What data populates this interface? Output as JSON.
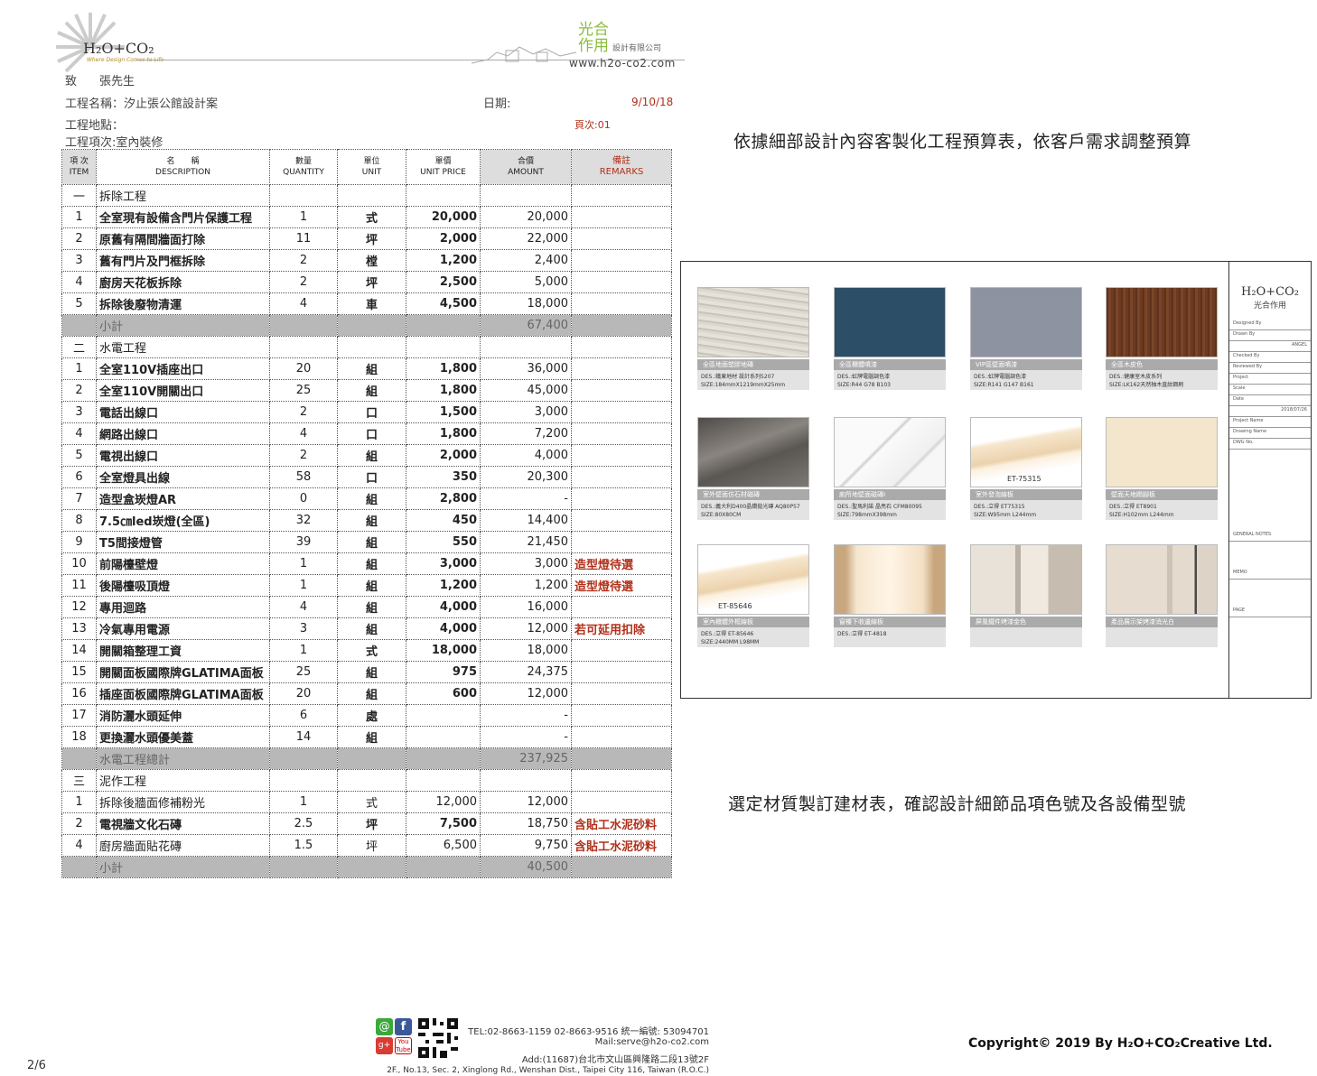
{
  "header": {
    "logo": "H₂O+CO₂",
    "logo_tagline": "Where Design Comes to Life",
    "brand_cn_1": "光合",
    "brand_cn_2": "作用",
    "brand_cn_small": "設計有限公司",
    "brand_url": "www.h2o-co2.com",
    "to_label": "致",
    "to_name": "張先生",
    "project_label": "工程名稱：汐止張公館設計案",
    "date_label": "日期:",
    "date_value": "9/10/18",
    "location_label": "工程地點：",
    "page_label": "頁次:01",
    "category_label": "工程項次:室內裝修"
  },
  "table": {
    "headers": {
      "item_cn": "項 次",
      "item_en": "ITEM",
      "desc_cn": "名　　稱",
      "desc_en": "DESCRIPTION",
      "qty_cn": "數量",
      "qty_en": "QUANTITY",
      "unit_cn": "單位",
      "unit_en": "UNIT",
      "price_cn": "單價",
      "price_en": "UNIT PRICE",
      "amount_cn": "合價",
      "amount_en": "AMOUNT",
      "remarks_cn": "備註",
      "remarks_en": "REMARKS"
    },
    "rows": [
      {
        "type": "section",
        "num": "一",
        "desc": "拆除工程"
      },
      {
        "type": "item",
        "num": "1",
        "desc": "全室現有設備含門片保護工程",
        "qty": "1",
        "unit": "式",
        "price": "20,000",
        "amount": "20,000",
        "rem": ""
      },
      {
        "type": "item",
        "num": "2",
        "desc": "原舊有隔間牆面打除",
        "qty": "11",
        "unit": "坪",
        "price": "2,000",
        "amount": "22,000",
        "rem": ""
      },
      {
        "type": "item",
        "num": "3",
        "desc": "舊有門片及門框拆除",
        "qty": "2",
        "unit": "樘",
        "price": "1,200",
        "amount": "2,400",
        "rem": ""
      },
      {
        "type": "item",
        "num": "4",
        "desc": "廚房天花板拆除",
        "qty": "2",
        "unit": "坪",
        "price": "2,500",
        "amount": "5,000",
        "rem": ""
      },
      {
        "type": "item",
        "num": "5",
        "desc": "拆除後廢物清運",
        "qty": "4",
        "unit": "車",
        "price": "4,500",
        "amount": "18,000",
        "rem": ""
      },
      {
        "type": "subtotal",
        "num": "",
        "desc": "小計",
        "amount": "67,400"
      },
      {
        "type": "section",
        "num": "二",
        "desc": "水電工程"
      },
      {
        "type": "item",
        "num": "1",
        "desc": "全室110V插座出口",
        "qty": "20",
        "unit": "組",
        "price": "1,800",
        "amount": "36,000",
        "rem": ""
      },
      {
        "type": "item",
        "num": "2",
        "desc": "全室110V開關出口",
        "qty": "25",
        "unit": "組",
        "price": "1,800",
        "amount": "45,000",
        "rem": ""
      },
      {
        "type": "item",
        "num": "3",
        "desc": "電話出線口",
        "qty": "2",
        "unit": "口",
        "price": "1,500",
        "amount": "3,000",
        "rem": ""
      },
      {
        "type": "item",
        "num": "4",
        "desc": "網路出線口",
        "qty": "4",
        "unit": "口",
        "price": "1,800",
        "amount": "7,200",
        "rem": ""
      },
      {
        "type": "item",
        "num": "5",
        "desc": "電視出線口",
        "qty": "2",
        "unit": "組",
        "price": "2,000",
        "amount": "4,000",
        "rem": ""
      },
      {
        "type": "item",
        "num": "6",
        "desc": "全室燈具出線",
        "qty": "58",
        "unit": "口",
        "price": "350",
        "amount": "20,300",
        "rem": ""
      },
      {
        "type": "item",
        "num": "7",
        "desc": "造型盒崁燈AR",
        "qty": "0",
        "unit": "組",
        "price": "2,800",
        "amount": "-",
        "rem": ""
      },
      {
        "type": "item",
        "num": "8",
        "desc": "7.5㎝led崁燈(全區)",
        "qty": "32",
        "unit": "組",
        "price": "450",
        "amount": "14,400",
        "rem": ""
      },
      {
        "type": "item",
        "num": "9",
        "desc": "T5間接燈管",
        "qty": "39",
        "unit": "組",
        "price": "550",
        "amount": "21,450",
        "rem": ""
      },
      {
        "type": "item",
        "num": "10",
        "desc": "前陽檯壁燈",
        "qty": "1",
        "unit": "組",
        "price": "3,000",
        "amount": "3,000",
        "rem": "造型燈待選"
      },
      {
        "type": "item",
        "num": "11",
        "desc": "後陽檯吸頂燈",
        "qty": "1",
        "unit": "組",
        "price": "1,200",
        "amount": "1,200",
        "rem": "造型燈待選"
      },
      {
        "type": "item",
        "num": "12",
        "desc": "專用迴路",
        "qty": "4",
        "unit": "組",
        "price": "4,000",
        "amount": "16,000",
        "rem": ""
      },
      {
        "type": "item",
        "num": "13",
        "desc": "冷氣專用電源",
        "qty": "3",
        "unit": "組",
        "price": "4,000",
        "amount": "12,000",
        "rem": "若可延用扣除"
      },
      {
        "type": "item",
        "num": "14",
        "desc": "開關箱整理工資",
        "qty": "1",
        "unit": "式",
        "price": "18,000",
        "amount": "18,000",
        "rem": ""
      },
      {
        "type": "item",
        "num": "15",
        "desc": "開關面板國際牌GLATIMA面板",
        "qty": "25",
        "unit": "組",
        "price": "975",
        "amount": "24,375",
        "rem": ""
      },
      {
        "type": "item",
        "num": "16",
        "desc": "插座面板國際牌GLATIMA面板",
        "qty": "20",
        "unit": "組",
        "price": "600",
        "amount": "12,000",
        "rem": ""
      },
      {
        "type": "item",
        "num": "17",
        "desc": "消防灑水頭延伸",
        "qty": "6",
        "unit": "處",
        "price": "",
        "amount": "-",
        "rem": ""
      },
      {
        "type": "item",
        "num": "18",
        "desc": "更換灑水頭優美蓋",
        "qty": "14",
        "unit": "組",
        "price": "",
        "amount": "-",
        "rem": ""
      },
      {
        "type": "subtotal",
        "num": "",
        "desc": "水電工程總計",
        "amount": "237,925"
      },
      {
        "type": "section",
        "num": "三",
        "desc": "泥作工程"
      },
      {
        "type": "item2",
        "num": "1",
        "desc": "拆除後牆面修補粉光",
        "qty": "1",
        "unit": "式",
        "price": "12,000",
        "amount": "12,000",
        "rem": ""
      },
      {
        "type": "item",
        "num": "2",
        "desc": "電視牆文化石磚",
        "qty": "2.5",
        "unit": "坪",
        "price": "7,500",
        "amount": "18,750",
        "rem": "含貼工水泥砂料"
      },
      {
        "type": "item2",
        "num": "4",
        "desc": "廚房牆面貼花磚",
        "qty": "1.5",
        "unit": "坪",
        "price": "6,500",
        "amount": "9,750",
        "rem": "含貼工水泥砂料"
      },
      {
        "type": "subtotal",
        "num": "",
        "desc": "小計",
        "amount": "40,500"
      }
    ]
  },
  "captions": {
    "budget": "依據細部設計內容客製化工程預算表，依客戶需求調整預算",
    "materials": "選定材質製訂建材表，確認設計細節品項色號及各設備型號"
  },
  "board": {
    "tiles": [
      {
        "name": "全區地面塑膠地磚",
        "desc1": "DES.:鐵東地材 設計系列5207",
        "desc2": "SIZE:184mmX1219mmX25mm",
        "color": "#d8d4cc",
        "style": "wood-light"
      },
      {
        "name": "全區櫃體噴漆",
        "desc1": "DES.:虹牌電腦調色漆",
        "desc2": "SIZE:R44 G78 B103",
        "color": "#2c4e67",
        "style": "solid"
      },
      {
        "name": "VIP區壁面噴漆",
        "desc1": "DES.:虹牌電腦調色漆",
        "desc2": "SIZE:R141 G147 B161",
        "color": "#8d93a1",
        "style": "solid"
      },
      {
        "name": "全區木皮色",
        "desc1": "DES.:健康室木皮系列",
        "desc2": "SIZE:LK162天然柚木直紋鋼刷",
        "color": "#6b3c22",
        "style": "wood-dark"
      },
      {
        "name": "室外壁面仿石材磁磚",
        "desc1": "DES.:義大利D400晶鑽拋光磚 AQ80P57",
        "desc2": "SIZE:80X80CM",
        "color": "#6e6a66",
        "style": "stone"
      },
      {
        "name": "廁所地壁面磁磚I",
        "desc1": "DES.:聖馬利諾 晶亮石 CFM80095",
        "desc2": "SIZE:798mmX398mm",
        "color": "#f2f2f2",
        "style": "marble"
      },
      {
        "name": "室外發泡線板",
        "desc1": "DES.:立得 ET75315",
        "desc2": "SIZE:W95mm L244mm",
        "color": "#f4e3c9",
        "style": "molding",
        "mlabel": "ET-75315"
      },
      {
        "name": "壁面天地踢腳板",
        "desc1": "DES.:立得 ET8901",
        "desc2": "SIZE:H102mm L244mm",
        "color": "#f3e6cd",
        "style": "solid"
      },
      {
        "name": "室內櫃體外框線板",
        "desc1": "DES.:立得 ET-85646",
        "desc2": "SIZE:2440MM L98MM",
        "color": "#f4e2c8",
        "style": "molding2",
        "mlabel": "ET-85646"
      },
      {
        "name": "窗檯下收邊線板",
        "desc1": "DES.:立得 ET-4818",
        "desc2": "",
        "color": "#f1dcc0",
        "style": "panel"
      },
      {
        "name": "屏風鐵件烤漆金色",
        "desc1": "",
        "desc2": "",
        "color": "#cfc6b8",
        "style": "bath"
      },
      {
        "name": "產品展示架烤漆消光白",
        "desc1": "",
        "desc2": "",
        "color": "#d9cfc2",
        "style": "shelf"
      }
    ],
    "titleblock": {
      "logo": "H₂O+CO₂",
      "sub": "光合作用",
      "rows": [
        "Designed By",
        "Drawn By",
        "Checked By",
        "Reviewed By",
        "Project",
        "Scale",
        "Date",
        "Project Name",
        "Drawing Name",
        "DWG No.",
        "GENERAL NOTES",
        "MEMO",
        "PAGE"
      ],
      "date": "2018/07/26",
      "drawn": "ANGEL"
    }
  },
  "footer": {
    "tel": "TEL:02-8663-1159  02-8663-9516  統一編號: 53094701",
    "mail": "Mail:serve@h2o-co2.com",
    "addr": "Add:(11687)台北市文山區興隆路二段13號2F",
    "addr_en": "2F., No.13, Sec. 2, Xinglong Rd., Wenshan Dist., Taipei City 116, Taiwan (R.O.C.)",
    "page": "2/6",
    "copyright": "Copyright© 2019 By H₂O+CO₂Creative Ltd."
  }
}
